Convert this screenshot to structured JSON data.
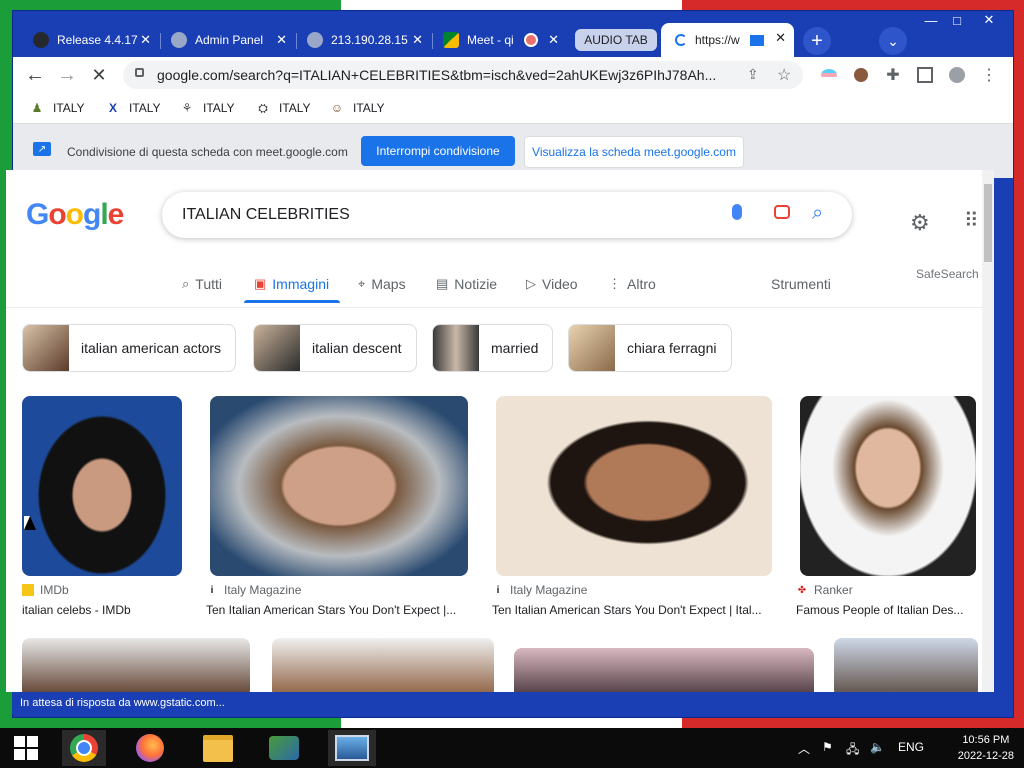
{
  "browser": {
    "tabs": [
      {
        "title": "Release 4.4.17",
        "icon": "github-icon"
      },
      {
        "title": "Admin Panel",
        "icon": "globe-icon"
      },
      {
        "title": "213.190.28.15",
        "icon": "globe-icon"
      },
      {
        "title": "Meet - qi",
        "icon": "meet-icon"
      },
      {
        "title": "https://w",
        "icon": "loading-icon"
      }
    ],
    "audio_tab_label": "AUDIO TAB",
    "new_tab": "+",
    "tab_menu": "⌄",
    "window_controls": {
      "minimize": "—",
      "maximize": "□",
      "close": "✕"
    },
    "url": "google.com/search?q=ITALIAN+CELEBRITIES&tbm=isch&ved=2ahUKEwj3z6PIhJ78Ah..."
  },
  "bookmarks": [
    {
      "label": "ITALY"
    },
    {
      "label": "ITALY"
    },
    {
      "label": "ITALY"
    },
    {
      "label": "ITALY"
    },
    {
      "label": "ITALY"
    }
  ],
  "share_bar": {
    "text": "Condivisione di questa scheda con meet.google.com",
    "stop_button": "Interrompi condivisione",
    "view_button": "Visualizza la scheda meet.google.com"
  },
  "google": {
    "logo_letters": [
      "G",
      "o",
      "o",
      "g",
      "l",
      "e"
    ],
    "logo_colors": [
      "#4285f4",
      "#ea4335",
      "#fbbc05",
      "#4285f4",
      "#34a853",
      "#ea4335"
    ],
    "query": "ITALIAN CELEBRITIES",
    "safesearch": "SafeSearch",
    "tools": "Strumenti",
    "nav": [
      {
        "label": "Tutti",
        "icon": "🔍"
      },
      {
        "label": "Immagini",
        "icon": "🖼"
      },
      {
        "label": "Maps",
        "icon": "⌖"
      },
      {
        "label": "Notizie",
        "icon": "▤"
      },
      {
        "label": "Video",
        "icon": "▷"
      },
      {
        "label": "Altro",
        "icon": "⋮"
      }
    ],
    "chips": [
      {
        "label": "italian american actors"
      },
      {
        "label": "italian descent"
      },
      {
        "label": "married"
      },
      {
        "label": "chiara ferragni"
      }
    ],
    "results": [
      {
        "source": "IMDb",
        "title": "italian celebs - IMDb"
      },
      {
        "source": "Italy Magazine",
        "title": "Ten Italian American Stars You Don't Expect |..."
      },
      {
        "source": "Italy Magazine",
        "title": "Ten Italian American Stars You Don't Expect | Ital..."
      },
      {
        "source": "Ranker",
        "title": "Famous People of Italian Des..."
      }
    ]
  },
  "status_text": "In attesa di risposta da www.gstatic.com...",
  "taskbar": {
    "language": "ENG",
    "time": "10:56 PM",
    "date": "2022-12-28"
  }
}
